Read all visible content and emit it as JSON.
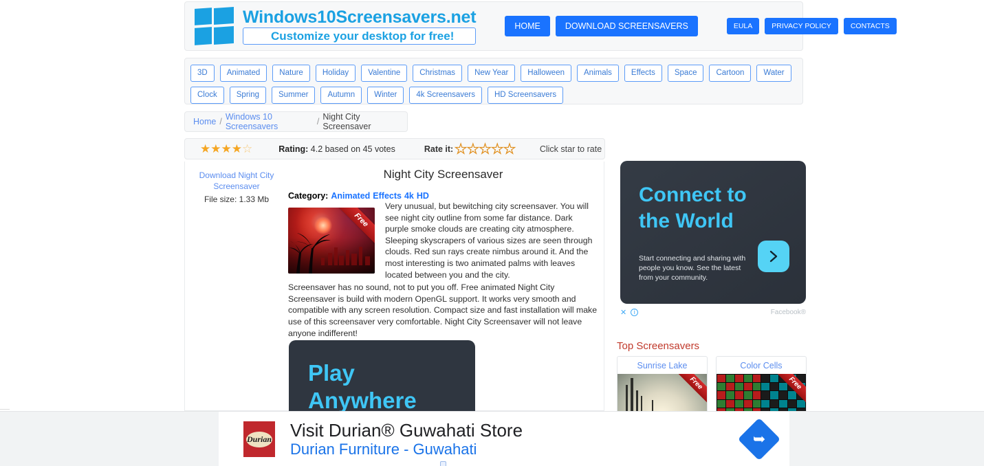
{
  "site": {
    "brand_name": "Windows10Screensavers.net",
    "tagline": "Customize your desktop for free!",
    "logo_icon": "windows-logo-icon"
  },
  "nav": {
    "primary": [
      {
        "label": "HOME"
      },
      {
        "label": "DOWNLOAD SCREENSAVERS"
      }
    ],
    "secondary": [
      {
        "label": "EULA"
      },
      {
        "label": "PRIVACY POLICY"
      },
      {
        "label": "CONTACTS"
      }
    ],
    "accent_color": "#1a73ff"
  },
  "categories": {
    "row1": [
      "3D",
      "Animated",
      "Nature",
      "Holiday",
      "Valentine",
      "Christmas",
      "New Year",
      "Halloween",
      "Animals",
      "Effects",
      "Space",
      "Cartoon",
      "Water"
    ],
    "row2": [
      "Clock",
      "Spring",
      "Summer",
      "Autumn",
      "Winter",
      "4k Screensavers",
      "HD Screensavers"
    ]
  },
  "breadcrumb": {
    "home": "Home",
    "section": "Windows 10 Screensavers",
    "current": "Night City Screensaver",
    "separator": "/"
  },
  "rating": {
    "stars_filled": 4,
    "stars_total": 5,
    "filled_glyph": "★",
    "empty_glyph": "☆",
    "label": "Rating:",
    "value": "4.2",
    "votes_text": "based on 45 votes",
    "rate_label": "Rate it:",
    "rate_stars": "☆☆☆☆☆",
    "hint": "Click star to rate",
    "star_color": "#f5a623"
  },
  "sidebar": {
    "download_link": "Download Night City Screensaver",
    "file_size": "File size: 1.33 Mb"
  },
  "main": {
    "title": "Night City Screensaver",
    "category_label": "Category:",
    "category_links": [
      "Animated",
      "Effects",
      "4k",
      "HD"
    ],
    "thumbnail": {
      "ribbon": "Free",
      "alt": "night-city-screensaver-thumbnail"
    },
    "paragraph1": "Very unusual, but bewitching city screensaver. You will see night city outline from some far distance. Dark purple smoke clouds are creating city atmosphere. Sleeping skyscrapers of various sizes are seen through clouds. Red sun rays create nimbus around it. And the most interesting is two animated palms with leaves located between you and the city.",
    "paragraph2": "Screensaver has no sound, not to put you off. Free animated Night City Screensaver is build with modern OpenGL support. It works very smooth and compatible with any screen resolution. Compact size and fast installation will make use of this screensaver very comfortable. Night City Screensaver will not leave anyone indifferent!"
  },
  "ad_play": {
    "headline_line1": "Play",
    "headline_line2": "Anywhere"
  },
  "ad_connect": {
    "headline_line1": "Connect to",
    "headline_line2": "the World",
    "body": "Start connecting and sharing with people you know. See the latest from your community.",
    "cta_icon": "chevron-right-icon",
    "close_icon": "close-icon",
    "info_icon": "info-icon",
    "close_glyph": "✕",
    "info_glyph": "i",
    "attribution": "Facebook®",
    "accent_color": "#3fc6f5"
  },
  "top_screensavers": {
    "title": "Top Screensavers",
    "items": [
      {
        "name": "Sunrise Lake",
        "ribbon": "Free"
      },
      {
        "name": "Color Cells",
        "ribbon": "Free"
      }
    ],
    "title_color": "#c0392b"
  },
  "bottom_ad": {
    "logo_text": "Durian",
    "headline": "Visit Durian® Guwahati Store",
    "subline": "Durian Furniture - Guwahati",
    "arrow_icon": "directions-arrow-icon",
    "arrow_glyph": "➥"
  }
}
